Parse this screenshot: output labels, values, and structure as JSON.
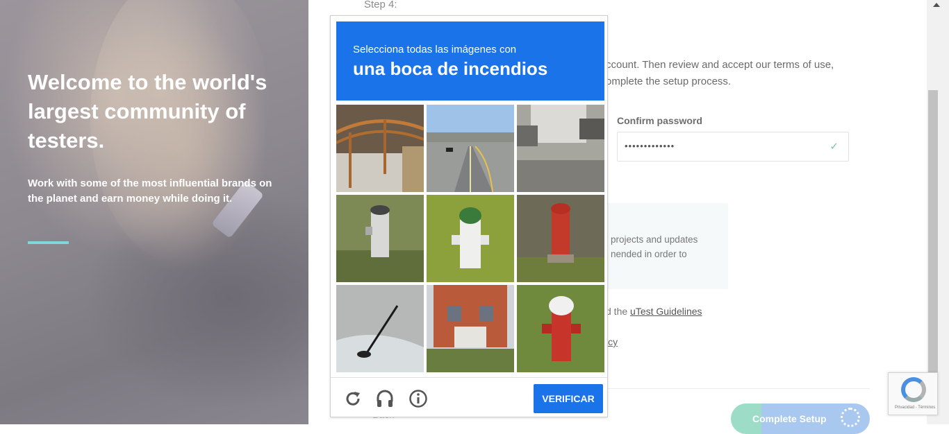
{
  "hero": {
    "title": "Welcome to the world's largest community of testers.",
    "subtitle": "Work with some of the most influential brands on the planet and earn money while doing it.",
    "accent_color": "#7fd6dc"
  },
  "form": {
    "step_label": "Step 4:",
    "intro_text": "ccount. Then review and accept our terms of use, omplete the setup process.",
    "confirm_password_label": "Confirm password",
    "confirm_password_value": "•••••••••••••",
    "info_text": "projects and updates nended in order to",
    "guidelines_prefix": "d the ",
    "guidelines_link": "uTest Guidelines",
    "policy_fragment": "icy",
    "back_label": "Back",
    "complete_label": "Complete Setup"
  },
  "captcha": {
    "instruction": "Selecciona todas las imágenes con",
    "target": "una boca de incendios",
    "verify_label": "VERIFICAR",
    "accent_color": "#1a73e8",
    "tiles": [
      {
        "name": "tile-carport",
        "icon": "carport"
      },
      {
        "name": "tile-road",
        "icon": "road"
      },
      {
        "name": "tile-truck",
        "icon": "truck"
      },
      {
        "name": "tile-hydrant-white",
        "icon": "hydrant"
      },
      {
        "name": "tile-hydrant-green",
        "icon": "hydrant"
      },
      {
        "name": "tile-hydrant-red",
        "icon": "hydrant"
      },
      {
        "name": "tile-car-antenna",
        "icon": "car"
      },
      {
        "name": "tile-house",
        "icon": "house"
      },
      {
        "name": "tile-hydrant-red-white",
        "icon": "hydrant"
      }
    ],
    "footer_icons": [
      "reload-icon",
      "audio-icon",
      "info-icon"
    ]
  },
  "badge": {
    "terms": "Privacidad - Términos"
  }
}
